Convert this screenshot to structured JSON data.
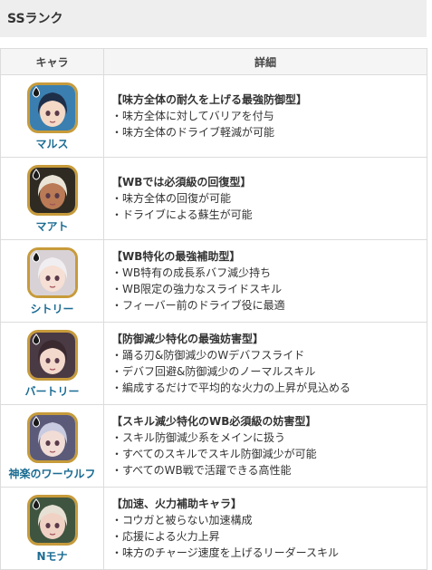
{
  "header": {
    "title": "SSランク"
  },
  "table": {
    "col_chara": "キャラ",
    "col_detail": "詳細",
    "rows": [
      {
        "name": "マルス",
        "title": "【味方全体の耐久を上げる最強防御型】",
        "items": [
          "・味方全体に対してバリアを付与",
          "・味方全体のドライブ軽減が可能"
        ]
      },
      {
        "name": "マアト",
        "title": "【WBでは必須級の回復型】",
        "items": [
          "・味方全体の回復が可能",
          "・ドライブによる蘇生が可能"
        ]
      },
      {
        "name": "シトリー",
        "title": "【WB特化の最強補助型】",
        "items": [
          "・WB特有の成長系バフ減少持ち",
          "・WB限定の強力なスライドスキル",
          "・フィーバー前のドライブ役に最適"
        ]
      },
      {
        "name": "バートリー",
        "title": "【防御減少特化の最強妨害型】",
        "items": [
          "・踊る刃&防御減少のWデバフスライド",
          "・デバフ回避&防御減少のノーマルスキル",
          "・編成するだけで平均的な火力の上昇が見込める"
        ]
      },
      {
        "name": "神楽のワーウルフ",
        "title": "【スキル減少特化のWB必須級の妨害型】",
        "items": [
          "・スキル防御減少系をメインに扱う",
          "・すべてのスキルでスキル防御減少が可能",
          "・すべてのWB戦で活躍できる高性能"
        ]
      },
      {
        "name": "Nモナ",
        "title": "【加速、火力補助キャラ】",
        "items": [
          "・コウガと被らない加速構成",
          "・応援による火力上昇",
          "・味方のチャージ速度を上げるリーダースキル"
        ]
      }
    ]
  },
  "colors": {
    "name_link": "#1b6c93",
    "frame_gold": "#c79b3b",
    "header_bg": "#eeeeee"
  },
  "avatars": [
    {
      "icon": "water-element-icon",
      "bg": "#3a7fb0",
      "hair": "#1e2f4a",
      "skin": "#f4d9c6"
    },
    {
      "icon": "light-element-icon",
      "bg": "#2f2a22",
      "hair": "#e9e4d6",
      "skin": "#b97a55"
    },
    {
      "icon": "light-element-icon",
      "bg": "#d8d2d6",
      "hair": "#f0eef0",
      "skin": "#f6dfd4"
    },
    {
      "icon": "wood-element-icon",
      "bg": "#4a3a44",
      "hair": "#3a2a30",
      "skin": "#f3d9cc"
    },
    {
      "icon": "wood-element-icon",
      "bg": "#5b5a78",
      "hair": "#c9cbe0",
      "skin": "#f1ddd6"
    },
    {
      "icon": "wood-element-icon",
      "bg": "#3f5540",
      "hair": "#e6e1d4",
      "skin": "#f0d2c4"
    }
  ]
}
